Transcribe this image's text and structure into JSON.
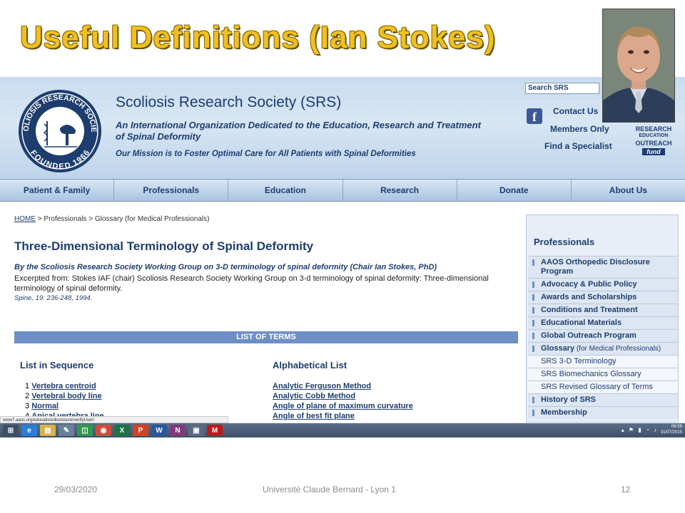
{
  "slide": {
    "title": "Useful Definitions (Ian Stokes)",
    "footer_date": "29/03/2020",
    "footer_center": "Université Claude Bernard - Lyon 1",
    "footer_page": "12"
  },
  "site": {
    "title": "Scoliosis Research Society (SRS)",
    "subtitle": "An International Organization Dedicated to the Education, Research and Treatment of Spinal Deformity",
    "mission": "Our Mission is to Foster Optimal Care for All Patients with Spinal Deformities",
    "logo_text_top": "SCOLIOSIS RESEARCH SOCIETY",
    "logo_text_bottom": "FOUNDED 1966",
    "search_placeholder": "Search SRS",
    "links": [
      "Contact Us",
      "Members Only",
      "Find a Specialist"
    ],
    "outreach_lines": [
      "RESEARCH",
      "EDUCATION",
      "OUTREACH"
    ],
    "outreach_fund": "fund"
  },
  "nav": [
    "Patient & Family",
    "Professionals",
    "Education",
    "Research",
    "Donate",
    "About Us"
  ],
  "content": {
    "breadcrumb_home": "HOME",
    "breadcrumb_rest": " > Professionals > Glossary (for Medical Professionals)",
    "heading": "Three-Dimensional Terminology of Spinal Deformity",
    "byline": "By the Scoliosis Research Society Working Group on 3-D terminology of spinal deformity (Chair Ian Stokes, PhD)",
    "excerpt": "Excerpted from: Stokes IAF (chair) Scoliosis Research Society Working Group on 3-d terminology of spinal deformity: Three-dimensional terminology of spinal deformity.",
    "citation": "Spine, 19: 236-248, 1994.",
    "terms_bar": "LIST OF TERMS",
    "seq_heading": "List in Sequence",
    "alpha_heading": "Alphabetical List",
    "seq_items": [
      {
        "num": "1",
        "label": "Vertebra centroid"
      },
      {
        "num": "2",
        "label": "Vertebral body line"
      },
      {
        "num": "3",
        "label": "Normal"
      },
      {
        "num": "4",
        "label": "Apical vertebra line"
      }
    ],
    "alpha_items": [
      "Analytic Ferguson Method",
      "Analytic Cobb Method",
      "Angle of plane of maximum curvature",
      "Angle of best fit plane"
    ]
  },
  "sidebar": {
    "title": "Professionals",
    "items": [
      {
        "label": "AAOS Orthopedic Disclosure Program",
        "small": "",
        "sub": false
      },
      {
        "label": "Advocacy & Public Policy",
        "small": "",
        "sub": false
      },
      {
        "label": "Awards and Scholarships",
        "small": "",
        "sub": false
      },
      {
        "label": "Conditions and Treatment",
        "small": "",
        "sub": false
      },
      {
        "label": "Educational Materials",
        "small": "",
        "sub": false
      },
      {
        "label": "Global Outreach Program",
        "small": "",
        "sub": false
      },
      {
        "label": "Glossary",
        "small": " (for Medical Professionals)",
        "sub": false
      },
      {
        "label": "SRS 3-D Terminology",
        "small": "",
        "sub": true
      },
      {
        "label": "SRS Biomechanics Glossary",
        "small": "",
        "sub": true
      },
      {
        "label": "SRS Revised Glossary of Terms",
        "small": "",
        "sub": true
      },
      {
        "label": "History of SRS",
        "small": "",
        "sub": false
      },
      {
        "label": "Membership",
        "small": "",
        "sub": false
      }
    ]
  },
  "browser": {
    "status_url": "www7.aaos.org/education/disclosure/verifyUser/",
    "clock_time": "06:59",
    "clock_date": "31/07/2015"
  },
  "taskbar": [
    {
      "icon": "windows-start-icon",
      "glyph": "⊞",
      "color": "#3e5068"
    },
    {
      "icon": "internet-explorer-icon",
      "glyph": "e",
      "color": "#2a7fd6"
    },
    {
      "icon": "file-explorer-icon",
      "glyph": "▤",
      "color": "#d8b24a"
    },
    {
      "icon": "notes-icon",
      "glyph": "✎",
      "color": "#6a7f9a"
    },
    {
      "icon": "store-icon",
      "glyph": "◫",
      "color": "#2e9a4a"
    },
    {
      "icon": "chrome-icon",
      "glyph": "◉",
      "color": "#d44a3a"
    },
    {
      "icon": "excel-icon",
      "glyph": "X",
      "color": "#207245"
    },
    {
      "icon": "powerpoint-icon",
      "glyph": "P",
      "color": "#d04423"
    },
    {
      "icon": "word-icon",
      "glyph": "W",
      "color": "#2b579a"
    },
    {
      "icon": "onenote-icon",
      "glyph": "N",
      "color": "#80397b"
    },
    {
      "icon": "remote-desktop-icon",
      "glyph": "▣",
      "color": "#5a6a80"
    },
    {
      "icon": "mcafee-icon",
      "glyph": "M",
      "color": "#c01818"
    }
  ],
  "colors": {
    "brand_navy": "#1d3d6e",
    "title_gold": "#f0c020",
    "bar_blue": "#6e8fc4"
  }
}
